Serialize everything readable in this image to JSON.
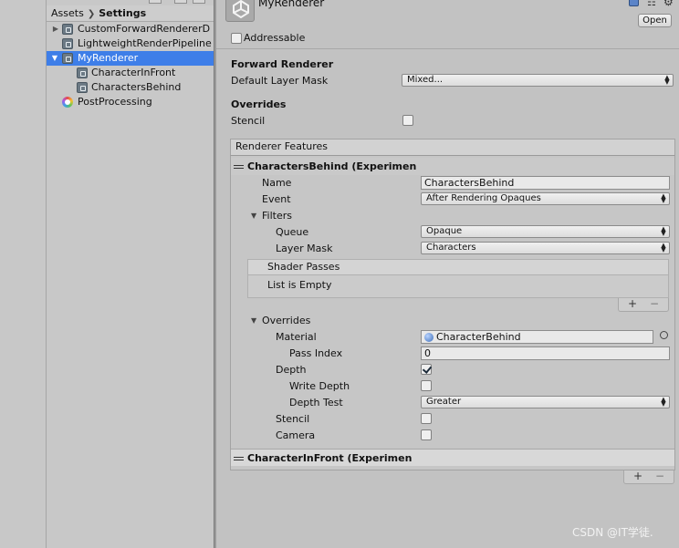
{
  "project": {
    "breadcrumb": [
      "Assets",
      "Settings"
    ],
    "tree": [
      {
        "label": "CustomForwardRendererD",
        "icon": "asset-icon",
        "arrow": "collapsed"
      },
      {
        "label": "LightweightRenderPipeline",
        "icon": "asset-icon",
        "arrow": "none"
      },
      {
        "label": "MyRenderer",
        "icon": "asset-icon",
        "arrow": "expanded",
        "selected": true
      },
      {
        "label": "CharacterInFront",
        "icon": "asset-icon",
        "arrow": "none"
      },
      {
        "label": "CharactersBehind",
        "icon": "asset-icon",
        "arrow": "none"
      },
      {
        "label": "PostProcessing",
        "icon": "postprocessing-icon",
        "arrow": "none"
      }
    ]
  },
  "inspector": {
    "title": "MyRenderer",
    "open_label": "Open",
    "addressable_label": "Addressable",
    "addressable_checked": false,
    "section_forward": "Forward Renderer",
    "default_layer_mask_label": "Default Layer Mask",
    "default_layer_mask_value": "Mixed...",
    "section_overrides": "Overrides",
    "stencil_label": "Stencil",
    "stencil_checked": false,
    "renderer_features_label": "Renderer Features",
    "features": [
      {
        "header": "CharactersBehind (Experimen",
        "name_label": "Name",
        "name_value": "CharactersBehind",
        "event_label": "Event",
        "event_value": "After Rendering Opaques",
        "filters_label": "Filters",
        "queue_label": "Queue",
        "queue_value": "Opaque",
        "layer_mask_label": "Layer Mask",
        "layer_mask_value": "Characters",
        "shader_passes_label": "Shader Passes",
        "shader_passes_empty": "List is Empty",
        "overrides_label": "Overrides",
        "material_label": "Material",
        "material_value": "CharacterBehind",
        "pass_index_label": "Pass Index",
        "pass_index_value": "0",
        "depth_label": "Depth",
        "depth_checked": true,
        "write_depth_label": "Write Depth",
        "write_depth_checked": false,
        "depth_test_label": "Depth Test",
        "depth_test_value": "Greater",
        "stencil_label": "Stencil",
        "stencil_checked": false,
        "camera_label": "Camera",
        "camera_checked": false
      },
      {
        "header": "CharacterInFront (Experimen"
      }
    ],
    "add_symbol": "+",
    "remove_symbol": "−"
  },
  "watermark": "CSDN @IT学徒."
}
